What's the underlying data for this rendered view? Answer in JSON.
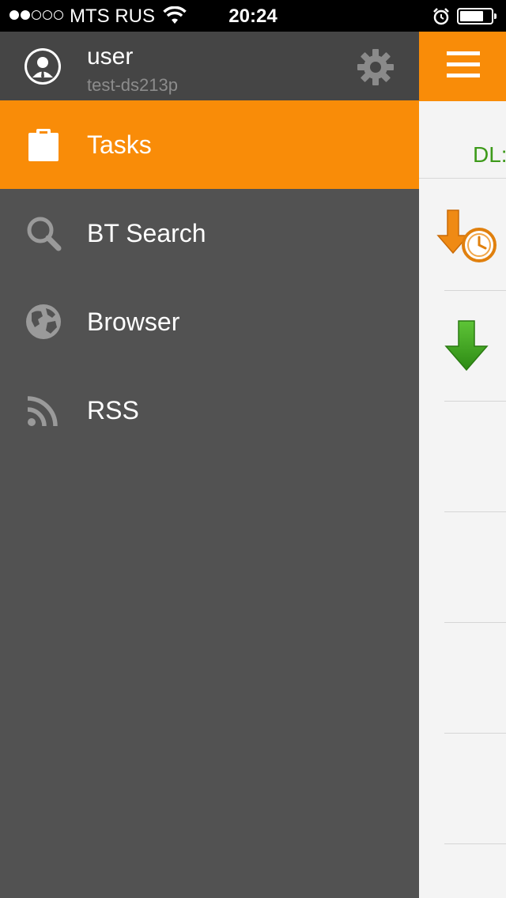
{
  "status_bar": {
    "carrier": "MTS RUS",
    "time": "20:24",
    "battery_level": 0.75
  },
  "drawer": {
    "user": {
      "name": "user",
      "host": "test-ds213p"
    },
    "items": [
      {
        "label": "Tasks",
        "icon": "clipboard-icon",
        "active": true
      },
      {
        "label": "BT Search",
        "icon": "search-icon",
        "active": false
      },
      {
        "label": "Browser",
        "icon": "globe-icon",
        "active": false
      },
      {
        "label": "RSS",
        "icon": "rss-icon",
        "active": false
      }
    ]
  },
  "content": {
    "summary_label": "DL:",
    "tasks": [
      {
        "status_icon": "download-waiting-icon"
      },
      {
        "status_icon": "download-active-icon"
      }
    ]
  },
  "colors": {
    "accent": "#f98c08",
    "drawer_bg": "#525252",
    "header_bg": "#454545",
    "download_green": "#3d9a1a"
  }
}
